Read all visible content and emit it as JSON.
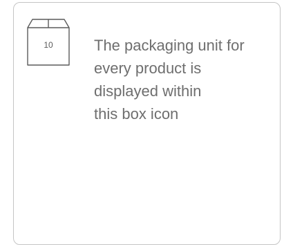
{
  "packaging_box": {
    "quantity": "10",
    "icon": "box-icon"
  },
  "description": {
    "lines": [
      "The packaging unit for",
      "every product is",
      "displayed within",
      "this box icon"
    ]
  },
  "colors": {
    "text": "#6e6e6e",
    "border": "#c4c4c4",
    "icon_stroke": "#5a5a5a",
    "background": "#ffffff"
  }
}
